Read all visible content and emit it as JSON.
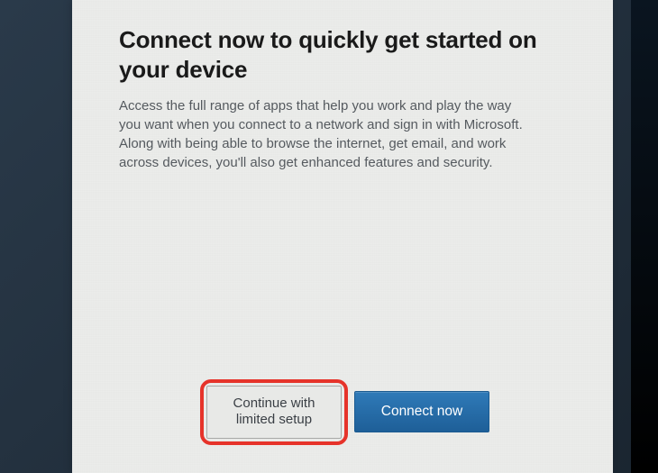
{
  "dialog": {
    "heading": "Connect now to quickly get started on your device",
    "description": "Access the full range of apps that help you work and play the way you want when you connect to a network and sign in with Microsoft. Along with being able to browse the internet, get email, and work across devices, you'll also get enhanced features and security."
  },
  "buttons": {
    "secondary_line1": "Continue with",
    "secondary_line2": "limited setup",
    "primary": "Connect now"
  }
}
